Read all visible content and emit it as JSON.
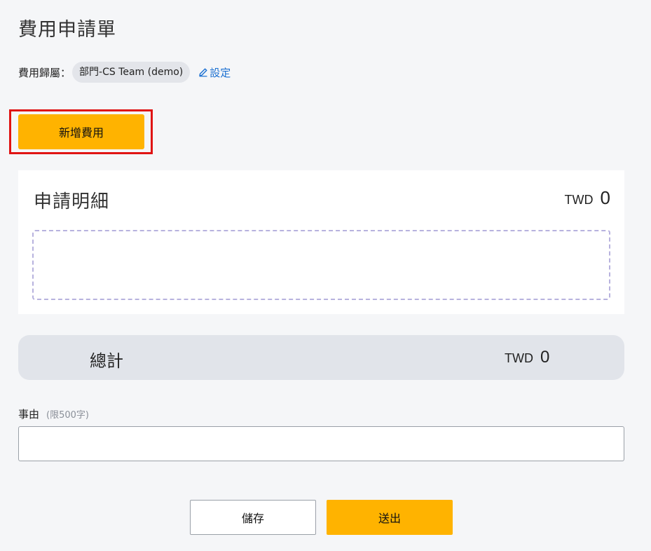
{
  "page": {
    "title": "費用申請單"
  },
  "belong": {
    "label": "費用歸屬：",
    "department": "部門-CS Team (demo)",
    "settings_link": "設定",
    "settings_icon": "pencil-edit-icon"
  },
  "actions": {
    "add_expense": "新增費用",
    "save": "儲存",
    "submit": "送出"
  },
  "detail": {
    "title": "申請明細",
    "currency": "TWD",
    "amount": "0"
  },
  "total": {
    "label": "總計",
    "currency": "TWD",
    "amount": "0"
  },
  "reason": {
    "label": "事由",
    "hint": "(限500字)",
    "value": "",
    "placeholder": ""
  },
  "colors": {
    "accent": "#ffb300",
    "link": "#1a6fd1",
    "highlight_border": "#e01414",
    "dropzone_border": "#b7b2de",
    "total_bg": "#e1e4ea"
  }
}
